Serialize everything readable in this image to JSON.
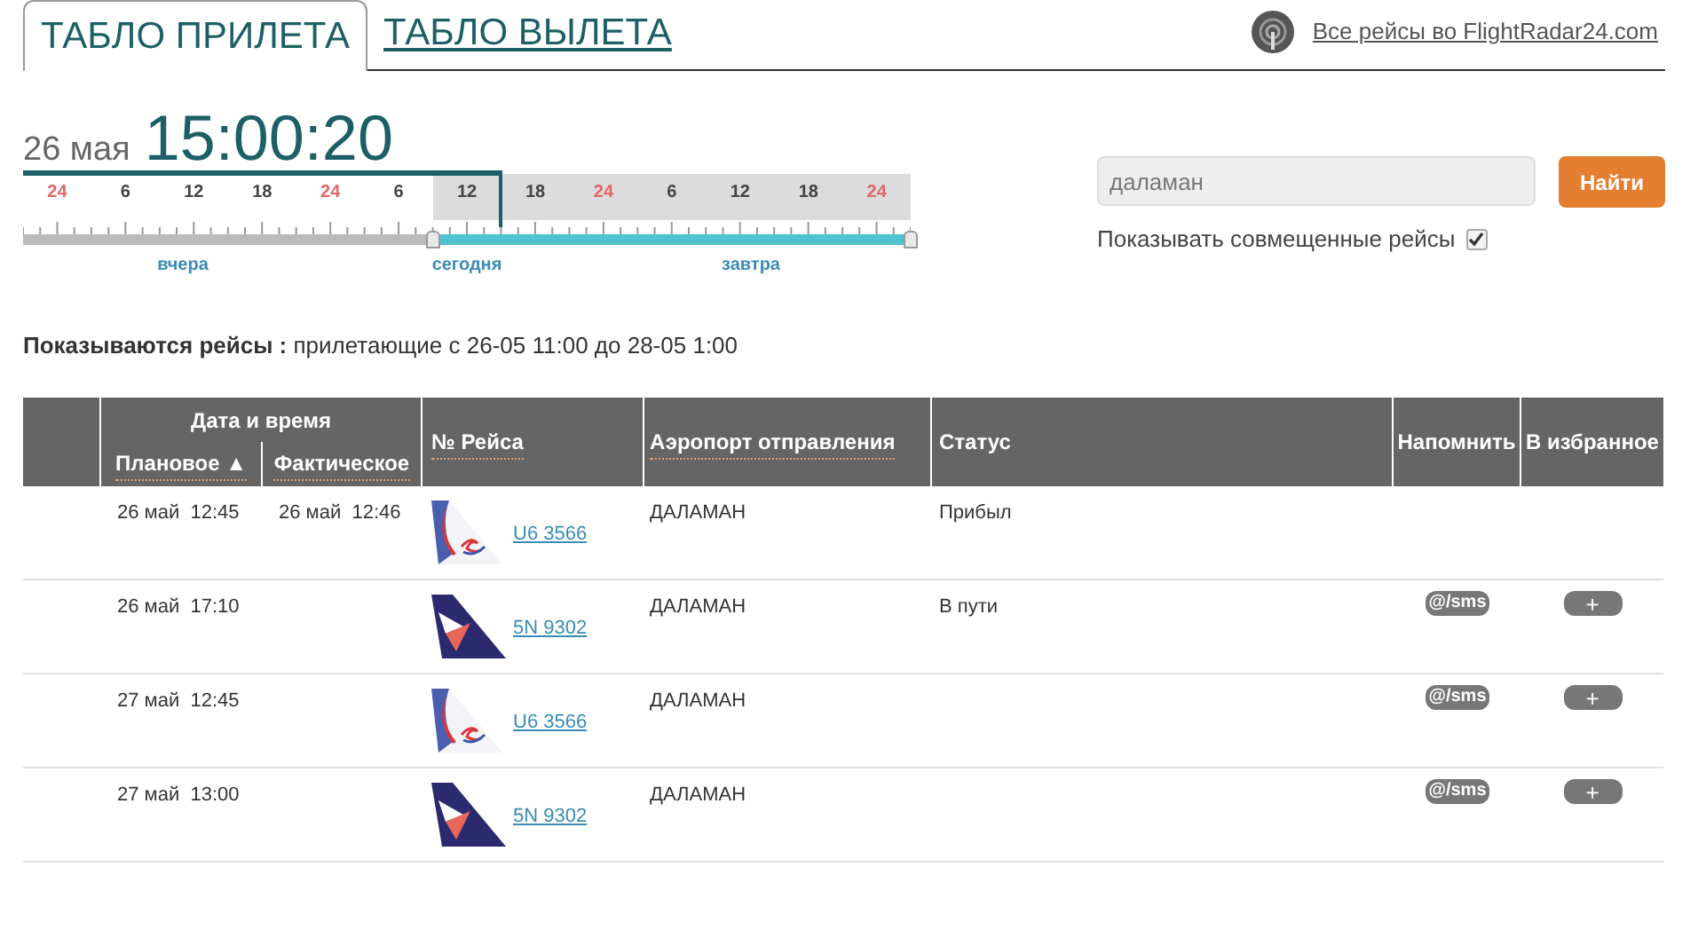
{
  "tabs": [
    {
      "label": "ТАБЛО ПРИЛЕТА",
      "selected": true
    },
    {
      "label": "ТАБЛО ВЫЛЕТА",
      "selected": false
    }
  ],
  "external_link": "Все рейсы во FlightRadar24.com",
  "clock": {
    "date": "26 мая",
    "time": "15:00:20"
  },
  "timeline": {
    "ticks": [
      {
        "label": "24",
        "color": "#e06666",
        "in_range": false
      },
      {
        "label": "6",
        "color": "#444444",
        "in_range": false
      },
      {
        "label": "12",
        "color": "#444444",
        "in_range": false
      },
      {
        "label": "18",
        "color": "#444444",
        "in_range": false
      },
      {
        "label": "24",
        "color": "#e06666",
        "in_range": false
      },
      {
        "label": "6",
        "color": "#444444",
        "in_range": false
      },
      {
        "label": "12",
        "color": "#444444",
        "in_range": true
      },
      {
        "label": "18",
        "color": "#444444",
        "in_range": true
      },
      {
        "label": "24",
        "color": "#e06666",
        "in_range": true
      },
      {
        "label": "6",
        "color": "#444444",
        "in_range": true
      },
      {
        "label": "12",
        "color": "#444444",
        "in_range": true
      },
      {
        "label": "18",
        "color": "#444444",
        "in_range": true
      },
      {
        "label": "24",
        "color": "#e06666",
        "in_range": true
      }
    ],
    "days": [
      "вчера",
      "сегодня",
      "завтра"
    ]
  },
  "search": {
    "value": "даламан",
    "button": "Найти",
    "combined_label": "Показывать совмещенные рейсы",
    "combined_checked": true
  },
  "summary": {
    "label": "Показываются рейсы :",
    "text": "прилетающие с 26-05 11:00 до 28-05 1:00"
  },
  "table": {
    "group_header": "Дата и время",
    "columns": [
      {
        "label": "Плановое ▲",
        "sortable": true
      },
      {
        "label": "Фактическое",
        "sortable": true
      },
      {
        "label": "№ Рейса",
        "sortable": true
      },
      {
        "label": "Аэропорт отправления",
        "sortable": true
      },
      {
        "label": "Статус",
        "sortable": false
      },
      {
        "label": "Напомнить",
        "sortable": false
      },
      {
        "label": "В избранное",
        "sortable": false
      }
    ],
    "rows": [
      {
        "planned": "26 май  12:45",
        "actual": "26 май  12:46",
        "kind": "ural",
        "flight": "U6 3566",
        "airport": "ДАЛАМАН",
        "status": "Прибыл"
      },
      {
        "planned": "26 май  17:10",
        "kind": "yakutia",
        "flight": "5N 9302",
        "airport": "ДАЛАМАН",
        "status": "В пути",
        "remind_button": "@/sms",
        "favorite_button": "+"
      },
      {
        "planned": "27 май  12:45",
        "kind": "ural",
        "flight": "U6 3566",
        "airport": "ДАЛАМАН",
        "remind_button": "@/sms",
        "favorite_button": "+"
      },
      {
        "planned": "27 май  13:00",
        "kind": "yakutia",
        "flight": "5N 9302",
        "airport": "ДАЛАМАН",
        "remind_button": "@/sms",
        "favorite_button": "+"
      }
    ]
  }
}
